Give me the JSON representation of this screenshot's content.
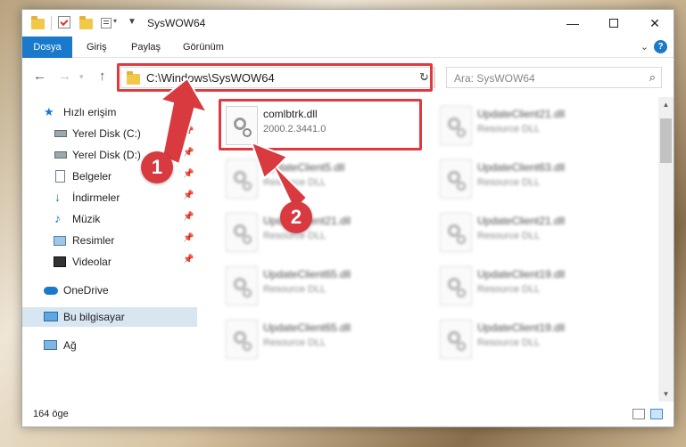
{
  "window": {
    "title": "SysWOW64"
  },
  "ribbon": {
    "tabs": [
      "Dosya",
      "Giriş",
      "Paylaş",
      "Görünüm"
    ],
    "help": "?"
  },
  "address": {
    "path": "C:\\Windows\\SysWOW64",
    "search_placeholder": "Ara: SysWOW64"
  },
  "sidebar": {
    "items": [
      {
        "label": "Hızlı erişim",
        "icon": "star-icon"
      },
      {
        "label": "Yerel Disk (C:)",
        "icon": "drive-icon"
      },
      {
        "label": "Yerel Disk (D:)",
        "icon": "drive-icon"
      },
      {
        "label": "Belgeler",
        "icon": "document-icon"
      },
      {
        "label": "İndirmeler",
        "icon": "download-icon"
      },
      {
        "label": "Müzik",
        "icon": "music-icon"
      },
      {
        "label": "Resimler",
        "icon": "pictures-icon"
      },
      {
        "label": "Videolar",
        "icon": "video-icon"
      },
      {
        "label": "OneDrive",
        "icon": "cloud-icon"
      },
      {
        "label": "Bu bilgisayar",
        "icon": "computer-icon"
      },
      {
        "label": "Ağ",
        "icon": "network-icon"
      }
    ]
  },
  "files": {
    "left": [
      {
        "name": "comlbtrk.dll",
        "sub": "2000.2.3441.0"
      },
      {
        "name": "UpdateClient5.dll",
        "sub": "Resource DLL"
      },
      {
        "name": "UpdateClient21.dll",
        "sub": "Resource DLL"
      },
      {
        "name": "UpdateClient65.dll",
        "sub": "Resource DLL"
      },
      {
        "name": "UpdateClient65.dll",
        "sub": "Resource DLL"
      }
    ],
    "right": [
      {
        "name": "UpdateClient21.dll",
        "sub": "Resource DLL"
      },
      {
        "name": "UpdateClient63.dll",
        "sub": "Resource DLL"
      },
      {
        "name": "UpdateClient21.dll",
        "sub": "Resource DLL"
      },
      {
        "name": "UpdateClient19.dll",
        "sub": "Resource DLL"
      },
      {
        "name": "UpdateClient19.dll",
        "sub": "Resource DLL"
      }
    ]
  },
  "status": {
    "count": "164 öge"
  },
  "callouts": [
    "1",
    "2"
  ],
  "colors": {
    "accent": "#1979ca",
    "highlight": "#e0393e",
    "callout": "#d83a40"
  }
}
